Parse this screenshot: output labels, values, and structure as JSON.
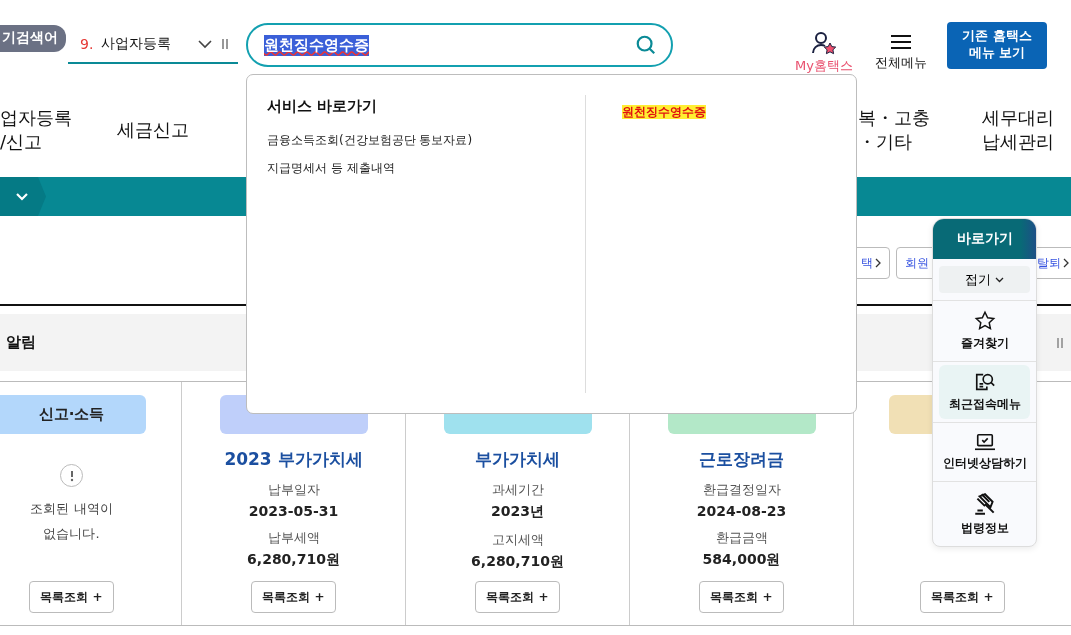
{
  "header": {
    "popular_badge": "기검색어",
    "popular_rank": "9.",
    "popular_keyword": "사업자등록",
    "search": {
      "value": "원천징수영수증"
    },
    "my_link": "My홈택스",
    "all_menu": "전체메뉴",
    "legacy_button": "기존 홈택스 메뉴 보기"
  },
  "nav": [
    {
      "lines": [
        "업자등록",
        "/신고"
      ]
    },
    {
      "lines": [
        "세금신고"
      ]
    },
    {
      "lines": [
        "복・고충",
        "・기타"
      ]
    },
    {
      "lines": [
        "세무대리",
        "납세관리"
      ]
    }
  ],
  "tags": [
    {
      "label": "택",
      "chevron": true
    },
    {
      "label": "회원",
      "chevron": false
    },
    {
      "label": "탈퇴",
      "chevron": true
    }
  ],
  "notice": {
    "title": "알림"
  },
  "cards": [
    {
      "tag": "신고·소득",
      "color": "#b3d7fb",
      "empty": "조회된 내역이 없습니다.",
      "button": "목록조회 +"
    },
    {
      "color": "#bfcffa",
      "title": "2023 부가가치세",
      "fields": [
        {
          "label": "납부일자",
          "value": "2023-05-31"
        },
        {
          "label": "납부세액",
          "value": "6,280,710원"
        }
      ],
      "button": "목록조회 +"
    },
    {
      "color": "#9fe1ee",
      "title": "부가가치세",
      "fields": [
        {
          "label": "과세기간",
          "value": "2023년"
        },
        {
          "label": "고지세액",
          "value": "6,280,710원"
        }
      ],
      "button": "목록조회 +"
    },
    {
      "color": "#b3e8c8",
      "title": "근로장려금",
      "fields": [
        {
          "label": "환급결정일자",
          "value": "2024-08-23"
        },
        {
          "label": "환급금액",
          "value": "584,000원"
        }
      ],
      "button": "목록조회 +"
    },
    {
      "color": "#f1e0b5",
      "button": "목록조회 +"
    }
  ],
  "search_dropdown": {
    "section_title": "서비스 바로가기",
    "services": [
      "금융소득조회(건강보험공단 통보자료)",
      "지급명세서 등 제출내역"
    ],
    "suggestions": [
      "원천징수영수증"
    ]
  },
  "quick_panel": {
    "title": "바로가기",
    "collapse": "접기",
    "items": [
      {
        "kind": "star",
        "label": "즐겨찾기",
        "selected": false
      },
      {
        "kind": "recent",
        "label": "최근접속메뉴",
        "selected": true
      },
      {
        "kind": "consult",
        "label": "인터넷상담하기",
        "selected": false
      },
      {
        "kind": "law",
        "label": "법령정보",
        "selected": false
      }
    ]
  }
}
